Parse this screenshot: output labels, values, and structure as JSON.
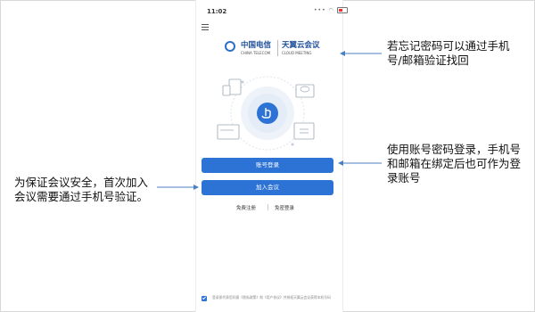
{
  "status_bar": {
    "time": "11:02",
    "signal": "•••"
  },
  "logo": {
    "company_cn": "中国电信",
    "company_en": "CHINA TELECOM",
    "product_cn": "天翼云会议",
    "product_en": "CLOUD MEETING"
  },
  "buttons": {
    "login": "账号登录",
    "join": "加入会议"
  },
  "links": {
    "register": "免费注册",
    "free_login": "免密登录"
  },
  "agreement": {
    "text": "登录即代表您同意《隐私政策》和《用户协议》并授权天翼云会议获得本机号码"
  },
  "annotations": {
    "forgot_password": "若忘记密码可以通过手机号/邮箱验证找回",
    "account_login": "使用账号密码登录，手机号和邮箱在绑定后也可作为登录账号",
    "join_meeting": "为保证会议安全，首次加入会议需要通过手机号验证。"
  },
  "colors": {
    "accent": "#2d73d6",
    "brand": "#1d4e9a",
    "arrow": "#4a7fc4"
  },
  "icons": [
    "menu-icon",
    "telecom-logo-icon",
    "touch-hand-icon",
    "wifi-icon",
    "battery-icon",
    "checkbox-icon"
  ]
}
